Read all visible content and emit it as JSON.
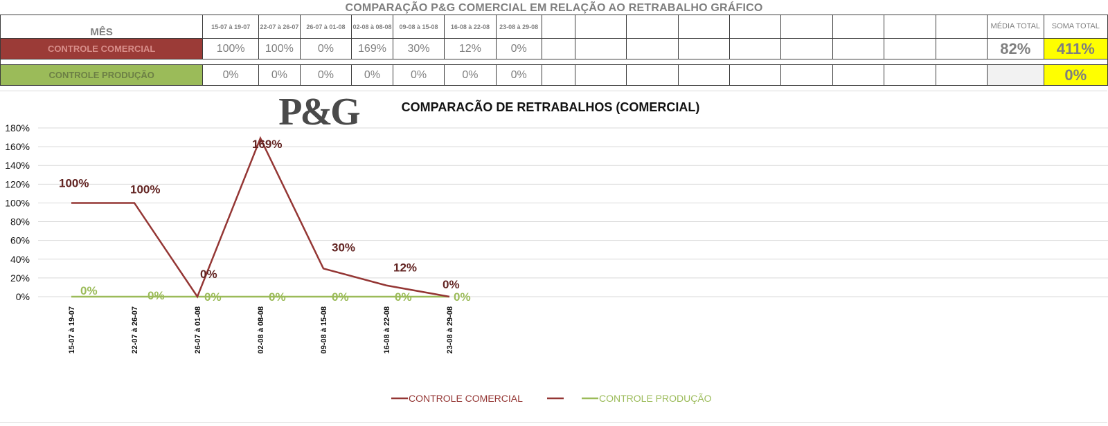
{
  "sheet": {
    "title": "COMPARAÇÃO P&G  COMERCIAL EM RELAÇÃO AO RETRABALHO GRÁFICO",
    "month_label": "MÊS",
    "week_headers": [
      "15-07 à 19-07",
      "22-07 à 26-07",
      "26-07 à 01-08",
      "02-08 à 08-08",
      "09-08 à 15-08",
      "16-08 à 22-08",
      "23-08 à 29-08"
    ],
    "media_header": "MÉDIA TOTAL",
    "soma_header": "SOMA TOTAL",
    "rows": [
      {
        "label": "CONTROLE COMERCIAL",
        "values": [
          "100%",
          "100%",
          "0%",
          "169%",
          "30%",
          "12%",
          "0%"
        ],
        "media": "82%",
        "soma": "411%"
      },
      {
        "label": "CONTROLE PRODUÇÃO",
        "values": [
          "0%",
          "0%",
          "0%",
          "0%",
          "0%",
          "0%",
          "0%"
        ],
        "media": "",
        "soma": "0%"
      }
    ]
  },
  "logo": {
    "text": "P&G"
  },
  "chart_data": {
    "type": "line",
    "title": "COMPARACÃO DE RETRABALHOS  (COMERCIAL)",
    "categories": [
      "15-07 à 19-07",
      "22-07 à 26-07",
      "26-07 à 01-08",
      "02-08 à 08-08",
      "09-08 à 15-08",
      "16-08 à 22-08",
      "23-08 à 29-08"
    ],
    "series": [
      {
        "name": "CONTROLE COMERCIAL",
        "values": [
          100,
          100,
          0,
          169,
          30,
          12,
          0
        ],
        "labels": [
          "100%",
          "100%",
          "0%",
          "169%",
          "30%",
          "12%",
          "0%"
        ],
        "color": "#943634"
      },
      {
        "name": "CONTROLE PRODUÇÃO",
        "values": [
          0,
          0,
          0,
          0,
          0,
          0,
          0
        ],
        "labels": [
          "0%",
          "0%",
          "0%",
          "0%",
          "0%",
          "0%",
          "0%"
        ],
        "color": "#9bbb59"
      }
    ],
    "y_ticks": [
      "0%",
      "20%",
      "40%",
      "60%",
      "80%",
      "100%",
      "120%",
      "140%",
      "160%",
      "180%"
    ],
    "ylim": [
      0,
      180
    ],
    "grid": true,
    "legend": {
      "position": "bottom",
      "extra_marker_color": "#943634"
    }
  }
}
